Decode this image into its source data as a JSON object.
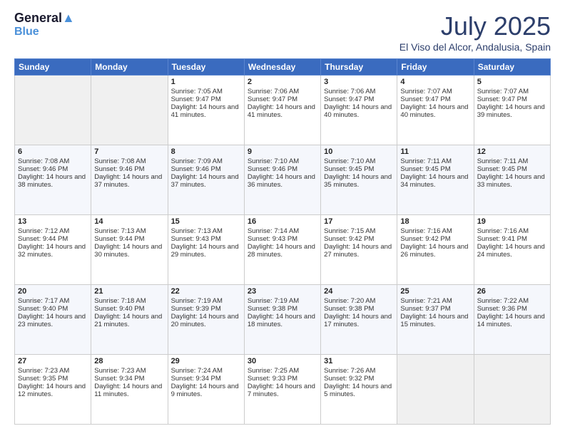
{
  "logo": {
    "line1": "General",
    "line2": "Blue"
  },
  "header": {
    "month": "July 2025",
    "location": "El Viso del Alcor, Andalusia, Spain"
  },
  "weekdays": [
    "Sunday",
    "Monday",
    "Tuesday",
    "Wednesday",
    "Thursday",
    "Friday",
    "Saturday"
  ],
  "weeks": [
    [
      {
        "day": "",
        "empty": true
      },
      {
        "day": "",
        "empty": true
      },
      {
        "day": "1",
        "sunrise": "7:05 AM",
        "sunset": "9:47 PM",
        "daylight": "14 hours and 41 minutes."
      },
      {
        "day": "2",
        "sunrise": "7:06 AM",
        "sunset": "9:47 PM",
        "daylight": "14 hours and 41 minutes."
      },
      {
        "day": "3",
        "sunrise": "7:06 AM",
        "sunset": "9:47 PM",
        "daylight": "14 hours and 40 minutes."
      },
      {
        "day": "4",
        "sunrise": "7:07 AM",
        "sunset": "9:47 PM",
        "daylight": "14 hours and 40 minutes."
      },
      {
        "day": "5",
        "sunrise": "7:07 AM",
        "sunset": "9:47 PM",
        "daylight": "14 hours and 39 minutes."
      }
    ],
    [
      {
        "day": "6",
        "sunrise": "7:08 AM",
        "sunset": "9:46 PM",
        "daylight": "14 hours and 38 minutes."
      },
      {
        "day": "7",
        "sunrise": "7:08 AM",
        "sunset": "9:46 PM",
        "daylight": "14 hours and 37 minutes."
      },
      {
        "day": "8",
        "sunrise": "7:09 AM",
        "sunset": "9:46 PM",
        "daylight": "14 hours and 37 minutes."
      },
      {
        "day": "9",
        "sunrise": "7:10 AM",
        "sunset": "9:46 PM",
        "daylight": "14 hours and 36 minutes."
      },
      {
        "day": "10",
        "sunrise": "7:10 AM",
        "sunset": "9:45 PM",
        "daylight": "14 hours and 35 minutes."
      },
      {
        "day": "11",
        "sunrise": "7:11 AM",
        "sunset": "9:45 PM",
        "daylight": "14 hours and 34 minutes."
      },
      {
        "day": "12",
        "sunrise": "7:11 AM",
        "sunset": "9:45 PM",
        "daylight": "14 hours and 33 minutes."
      }
    ],
    [
      {
        "day": "13",
        "sunrise": "7:12 AM",
        "sunset": "9:44 PM",
        "daylight": "14 hours and 32 minutes."
      },
      {
        "day": "14",
        "sunrise": "7:13 AM",
        "sunset": "9:44 PM",
        "daylight": "14 hours and 30 minutes."
      },
      {
        "day": "15",
        "sunrise": "7:13 AM",
        "sunset": "9:43 PM",
        "daylight": "14 hours and 29 minutes."
      },
      {
        "day": "16",
        "sunrise": "7:14 AM",
        "sunset": "9:43 PM",
        "daylight": "14 hours and 28 minutes."
      },
      {
        "day": "17",
        "sunrise": "7:15 AM",
        "sunset": "9:42 PM",
        "daylight": "14 hours and 27 minutes."
      },
      {
        "day": "18",
        "sunrise": "7:16 AM",
        "sunset": "9:42 PM",
        "daylight": "14 hours and 26 minutes."
      },
      {
        "day": "19",
        "sunrise": "7:16 AM",
        "sunset": "9:41 PM",
        "daylight": "14 hours and 24 minutes."
      }
    ],
    [
      {
        "day": "20",
        "sunrise": "7:17 AM",
        "sunset": "9:40 PM",
        "daylight": "14 hours and 23 minutes."
      },
      {
        "day": "21",
        "sunrise": "7:18 AM",
        "sunset": "9:40 PM",
        "daylight": "14 hours and 21 minutes."
      },
      {
        "day": "22",
        "sunrise": "7:19 AM",
        "sunset": "9:39 PM",
        "daylight": "14 hours and 20 minutes."
      },
      {
        "day": "23",
        "sunrise": "7:19 AM",
        "sunset": "9:38 PM",
        "daylight": "14 hours and 18 minutes."
      },
      {
        "day": "24",
        "sunrise": "7:20 AM",
        "sunset": "9:38 PM",
        "daylight": "14 hours and 17 minutes."
      },
      {
        "day": "25",
        "sunrise": "7:21 AM",
        "sunset": "9:37 PM",
        "daylight": "14 hours and 15 minutes."
      },
      {
        "day": "26",
        "sunrise": "7:22 AM",
        "sunset": "9:36 PM",
        "daylight": "14 hours and 14 minutes."
      }
    ],
    [
      {
        "day": "27",
        "sunrise": "7:23 AM",
        "sunset": "9:35 PM",
        "daylight": "14 hours and 12 minutes."
      },
      {
        "day": "28",
        "sunrise": "7:23 AM",
        "sunset": "9:34 PM",
        "daylight": "14 hours and 11 minutes."
      },
      {
        "day": "29",
        "sunrise": "7:24 AM",
        "sunset": "9:34 PM",
        "daylight": "14 hours and 9 minutes."
      },
      {
        "day": "30",
        "sunrise": "7:25 AM",
        "sunset": "9:33 PM",
        "daylight": "14 hours and 7 minutes."
      },
      {
        "day": "31",
        "sunrise": "7:26 AM",
        "sunset": "9:32 PM",
        "daylight": "14 hours and 5 minutes."
      },
      {
        "day": "",
        "empty": true
      },
      {
        "day": "",
        "empty": true
      }
    ]
  ]
}
